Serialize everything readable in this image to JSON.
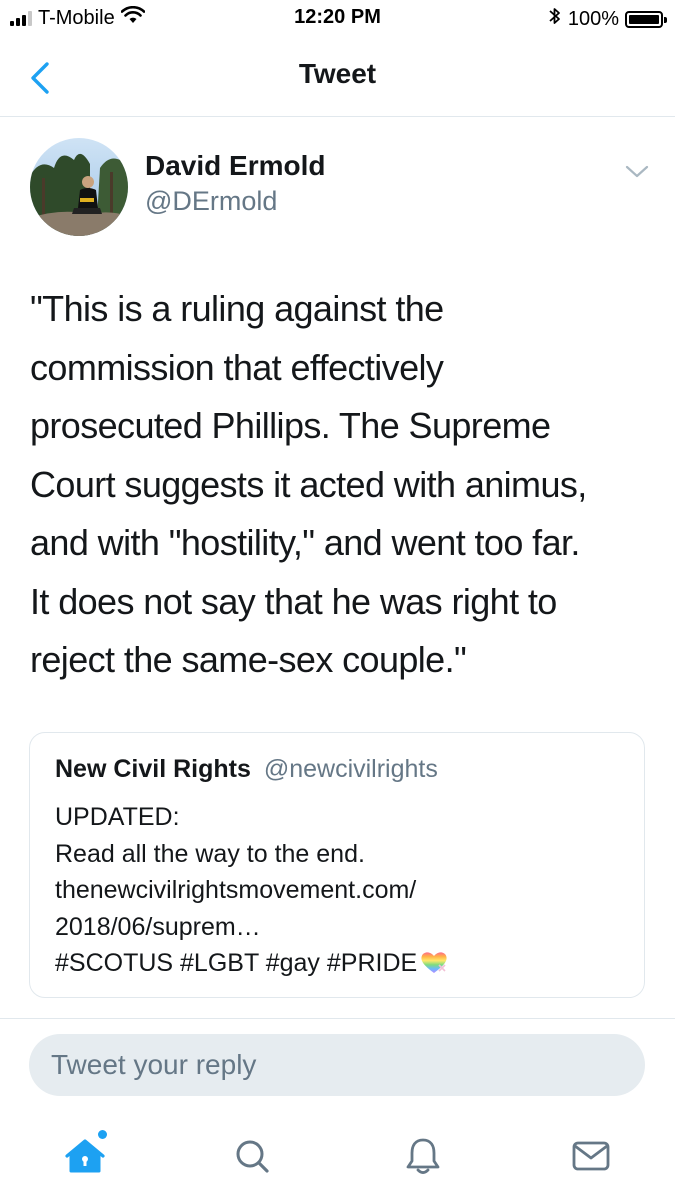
{
  "status_bar": {
    "carrier": "T-Mobile",
    "time": "12:20 PM",
    "battery_percent": "100%",
    "battery_level": 1.0,
    "signal_bars_filled": 3,
    "signal_bars_total": 4,
    "icons": [
      "signal-icon",
      "wifi-icon",
      "bluetooth-icon",
      "battery-icon"
    ]
  },
  "header": {
    "title": "Tweet",
    "back_icon": "chevron-left-icon"
  },
  "tweet": {
    "author_name": "David Ermold",
    "author_handle": "@DErmold",
    "text_lines": [
      "\"This is a ruling against the",
      "commission that effectively",
      "prosecuted Phillips. The Supreme",
      "Court suggests it acted with animus,",
      "and with \"hostility,\" and went too far.",
      "It does not say that he was right to",
      "reject the same-sex couple.\""
    ],
    "options_icon": "chevron-down-icon"
  },
  "quoted_tweet": {
    "author_name": "New Civil Rights",
    "author_handle": "@newcivilrights",
    "text_lines": [
      "UPDATED:",
      "Read all the way to the end.",
      "thenewcivilrightsmovement.com/",
      "2018/06/suprem…",
      "#SCOTUS #LGBT #gay #PRIDE"
    ],
    "emoji": "rainbow-heart-emoji"
  },
  "reply": {
    "placeholder": "Tweet your reply"
  },
  "tab_bar": {
    "items": [
      "home-icon",
      "search-icon",
      "notifications-icon",
      "messages-icon"
    ],
    "active": "home-icon"
  },
  "colors": {
    "accent": "#1da1f2",
    "text": "#14171a",
    "secondary_text": "#657786",
    "border": "#e1e8ed",
    "reply_bg": "#e6ecf0"
  }
}
